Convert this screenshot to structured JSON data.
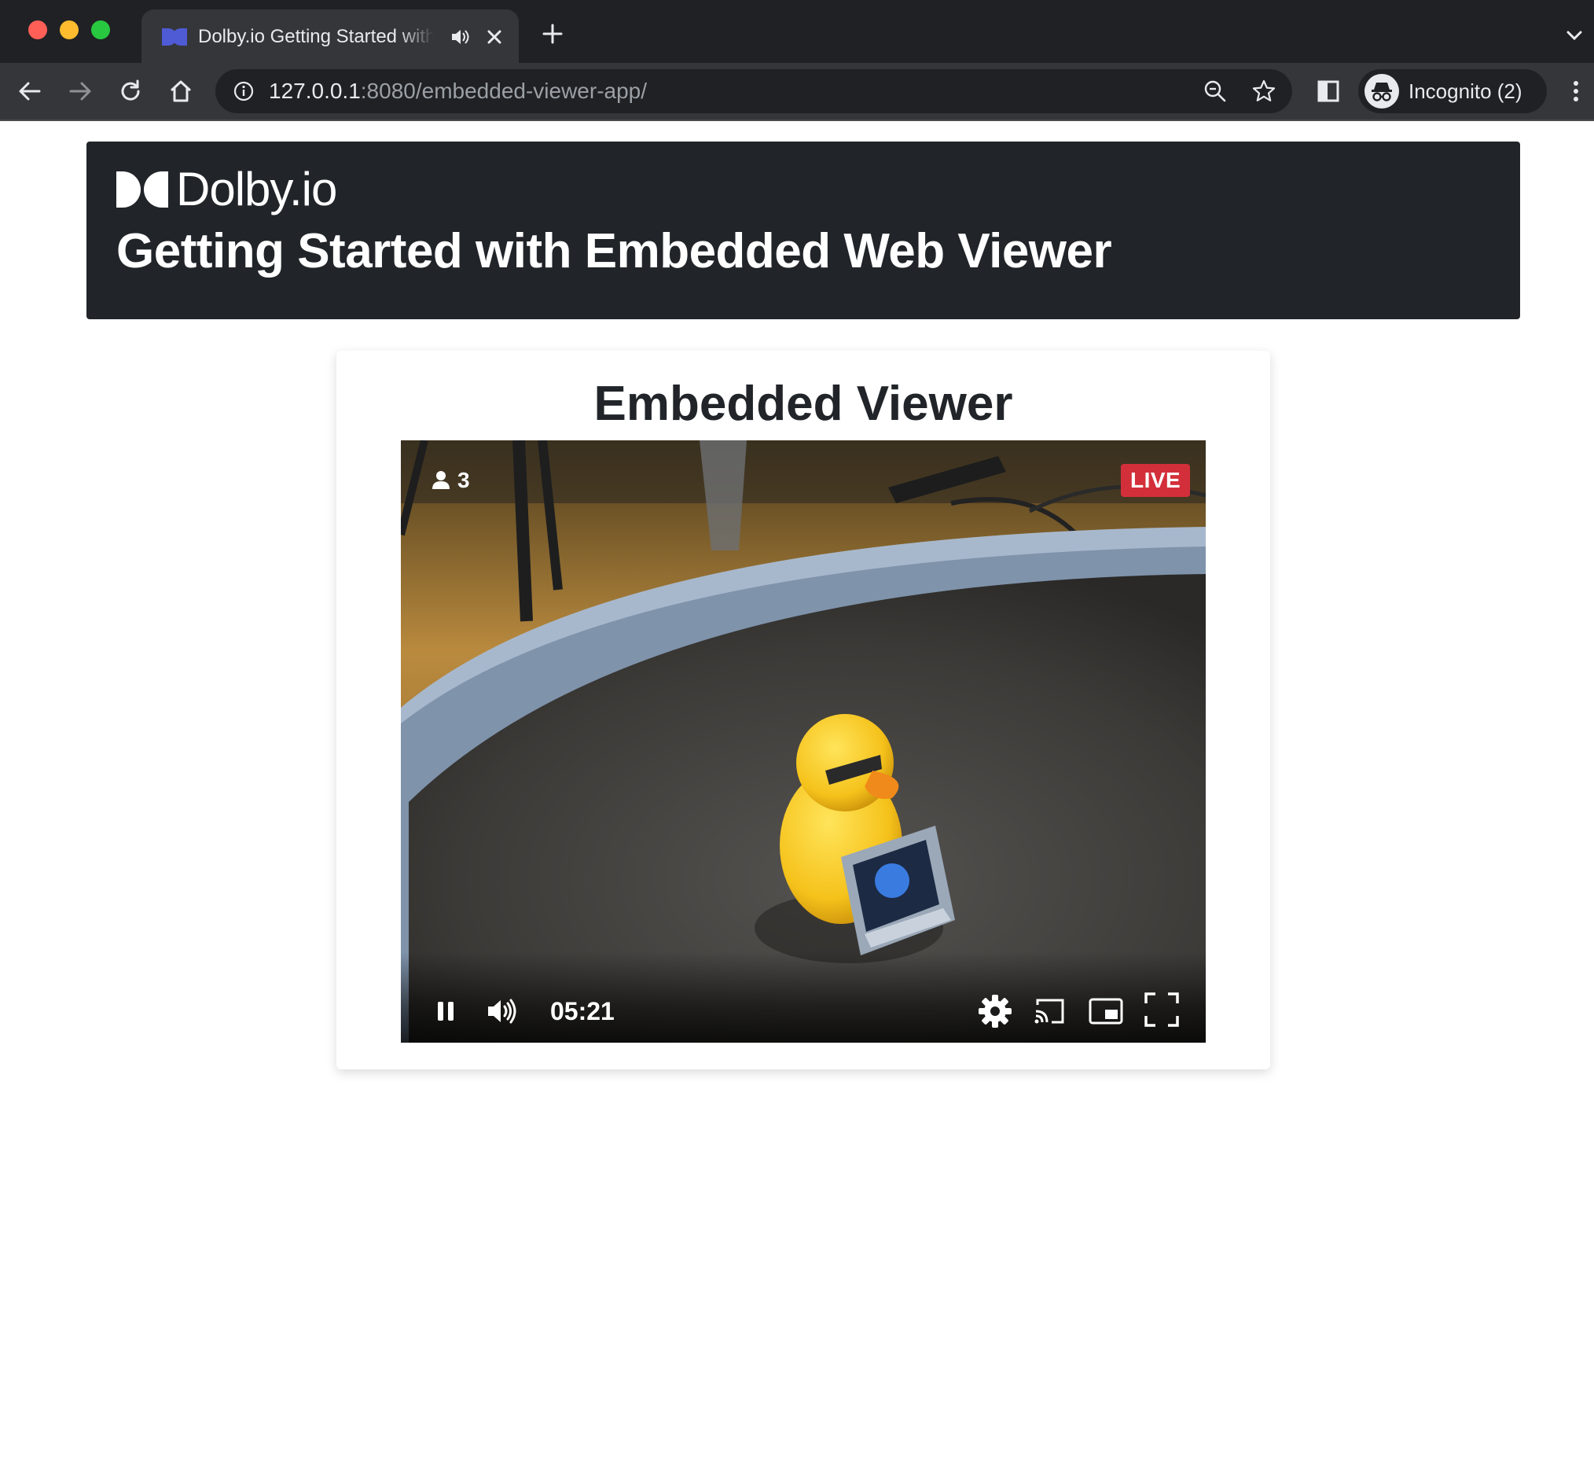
{
  "browser": {
    "tab": {
      "title": "Dolby.io Getting Started with Embedded Viewer",
      "favicon_icon": "dolby-favicon-icon",
      "audio_icon": "speaker-icon",
      "close_icon": "close-icon"
    },
    "new_tab_icon": "plus-icon",
    "tab_search_icon": "chevron-down-icon",
    "nav": {
      "back_icon": "back-arrow-icon",
      "forward_icon": "forward-arrow-icon",
      "reload_icon": "reload-icon",
      "home_icon": "home-icon"
    },
    "address": {
      "host": "127.0.0.1",
      "rest": ":8080/embedded-viewer-app/"
    },
    "profile_label": "Incognito (2)",
    "accent_colors": {
      "chrome_dark": "#202124",
      "chrome_toolbar": "#35363a"
    }
  },
  "page": {
    "logo_text": "Dolby",
    "logo_suffix": ".io",
    "heading": "Getting Started with Embedded Web Viewer",
    "card_title": "Embedded Viewer",
    "player": {
      "viewer_count": "3",
      "live_label": "LIVE",
      "time": "05:21",
      "live_color": "#d32f3a"
    }
  }
}
